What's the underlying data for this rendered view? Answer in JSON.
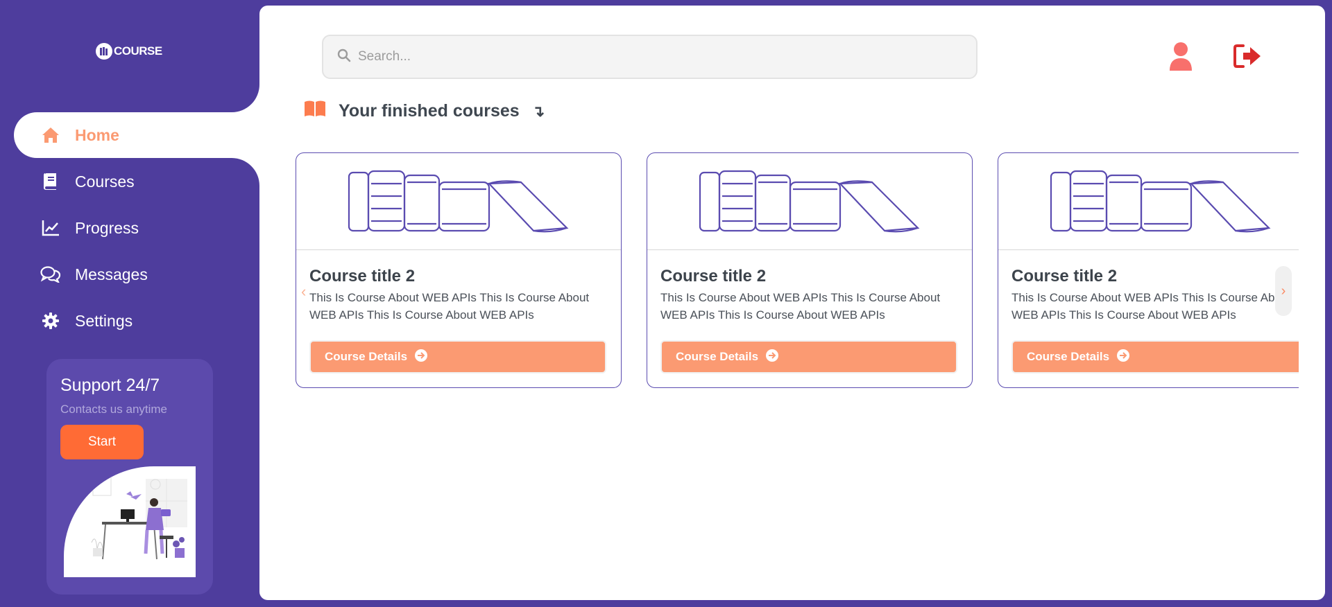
{
  "brand": {
    "logo_text": "COURSE"
  },
  "sidebar": {
    "items": [
      {
        "label": "Home",
        "icon": "home-icon",
        "active": true
      },
      {
        "label": "Courses",
        "icon": "book-icon",
        "active": false
      },
      {
        "label": "Progress",
        "icon": "chart-line-icon",
        "active": false
      },
      {
        "label": "Messages",
        "icon": "chat-icon",
        "active": false
      },
      {
        "label": "Settings",
        "icon": "gear-icon",
        "active": false
      }
    ]
  },
  "support": {
    "title": "Support 24/7",
    "subtitle": "Contacts us anytime",
    "button_label": "Start"
  },
  "header": {
    "search_placeholder": "Search...",
    "user_icon": "user-icon",
    "logout_icon": "logout-icon"
  },
  "section": {
    "title": "Your finished courses",
    "arrow": "↴"
  },
  "courses": [
    {
      "title": "Course title 2",
      "description": "This Is Course About WEB APIs This Is Course About WEB APIs This Is Course About WEB APIs",
      "button_label": "Course Details"
    },
    {
      "title": "Course title 2",
      "description": "This Is Course About WEB APIs This Is Course About WEB APIs This Is Course About WEB APIs",
      "button_label": "Course Details"
    },
    {
      "title": "Course title 2",
      "description": "This Is Course About WEB APIs This Is Course About WEB APIs This Is Course About WEB APIs",
      "button_label": "Course Details"
    }
  ],
  "carousel": {
    "prev": "‹",
    "next": "›"
  },
  "colors": {
    "primary": "#4e3d9d",
    "accent": "#fb9a72",
    "cta": "#ff6b35",
    "danger": "#d92b2b"
  }
}
